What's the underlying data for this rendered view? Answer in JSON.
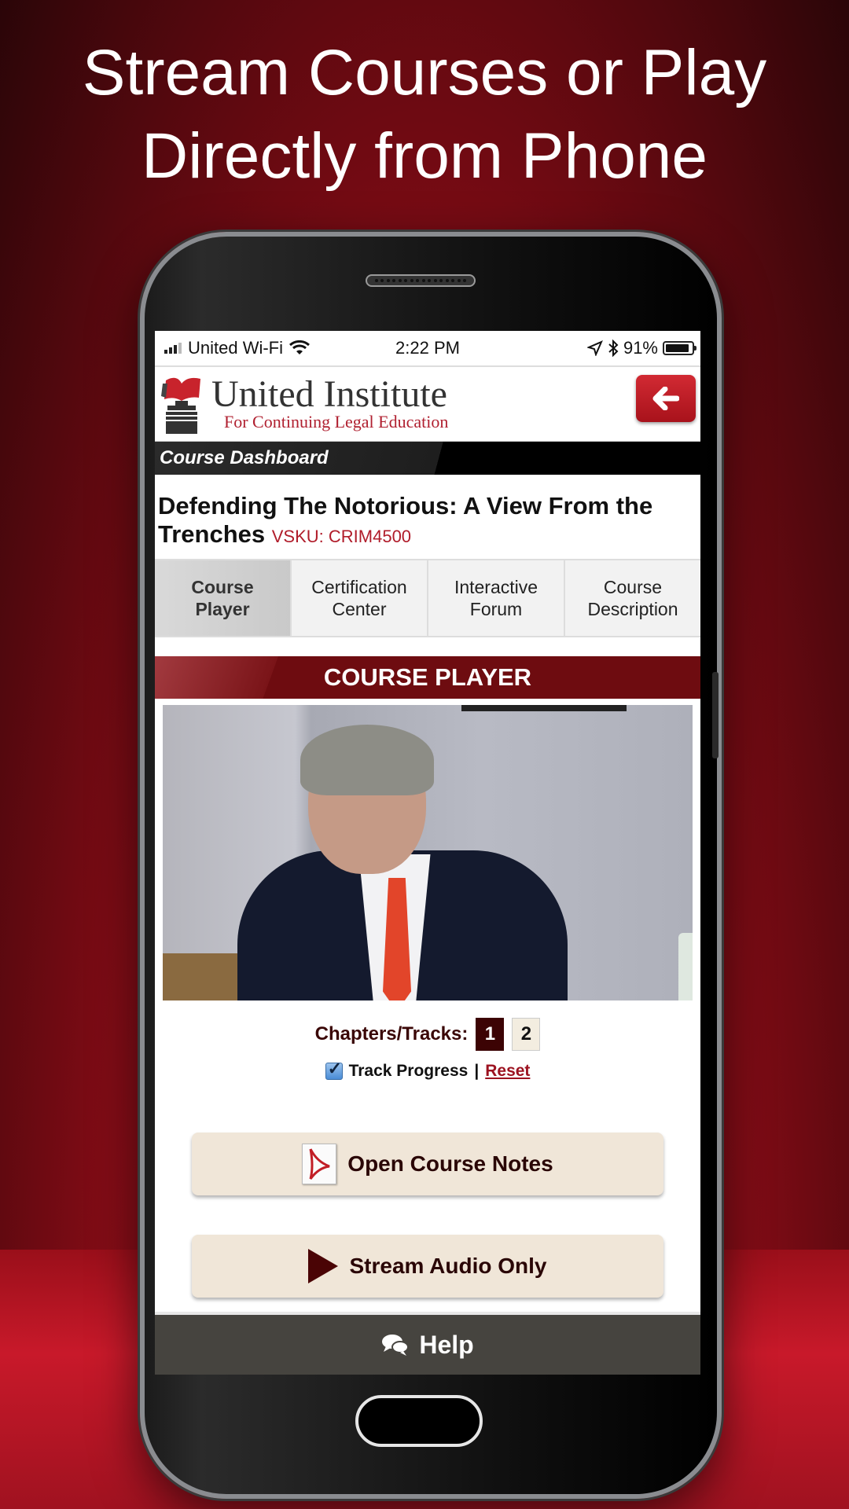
{
  "headline": {
    "line1": "Stream Courses or Play",
    "line2": "Directly from Phone"
  },
  "status_bar": {
    "carrier": "United Wi-Fi",
    "time": "2:22 PM",
    "battery": "91%",
    "battery_level": 0.91,
    "icons": [
      "signal-icon",
      "wifi-icon",
      "location-icon",
      "bluetooth-icon",
      "battery-icon"
    ]
  },
  "header": {
    "logo_title": "United Institute",
    "logo_subtitle": "For Continuing Legal Education",
    "back_button_icon": "arrow-left-icon"
  },
  "dashboard": {
    "label": "Course Dashboard"
  },
  "course": {
    "title": "Defending The Notorious: A View From the Trenches",
    "sku": "VSKU: CRIM4500"
  },
  "tabs": [
    {
      "line1": "Course",
      "line2": "Player",
      "active": true
    },
    {
      "line1": "Certification",
      "line2": "Center",
      "active": false
    },
    {
      "line1": "Interactive",
      "line2": "Forum",
      "active": false
    },
    {
      "line1": "Course",
      "line2": "Description",
      "active": false
    }
  ],
  "player": {
    "heading": "COURSE PLAYER",
    "chapters_label": "Chapters/Tracks:",
    "chapters": [
      "1",
      "2"
    ],
    "active_chapter": "1",
    "track_progress_label": "Track Progress",
    "track_progress_checked": true,
    "separator": "|",
    "reset_label": "Reset"
  },
  "actions": {
    "open_notes_label": "Open Course Notes",
    "stream_audio_label": "Stream Audio Only"
  },
  "help": {
    "label": "Help"
  },
  "colors": {
    "brand_red": "#b01c2a",
    "player_maroon": "#6e0c10",
    "chapter_active": "#3c0304",
    "button_beige": "#f0e6d8",
    "help_bar": "#46443f"
  }
}
